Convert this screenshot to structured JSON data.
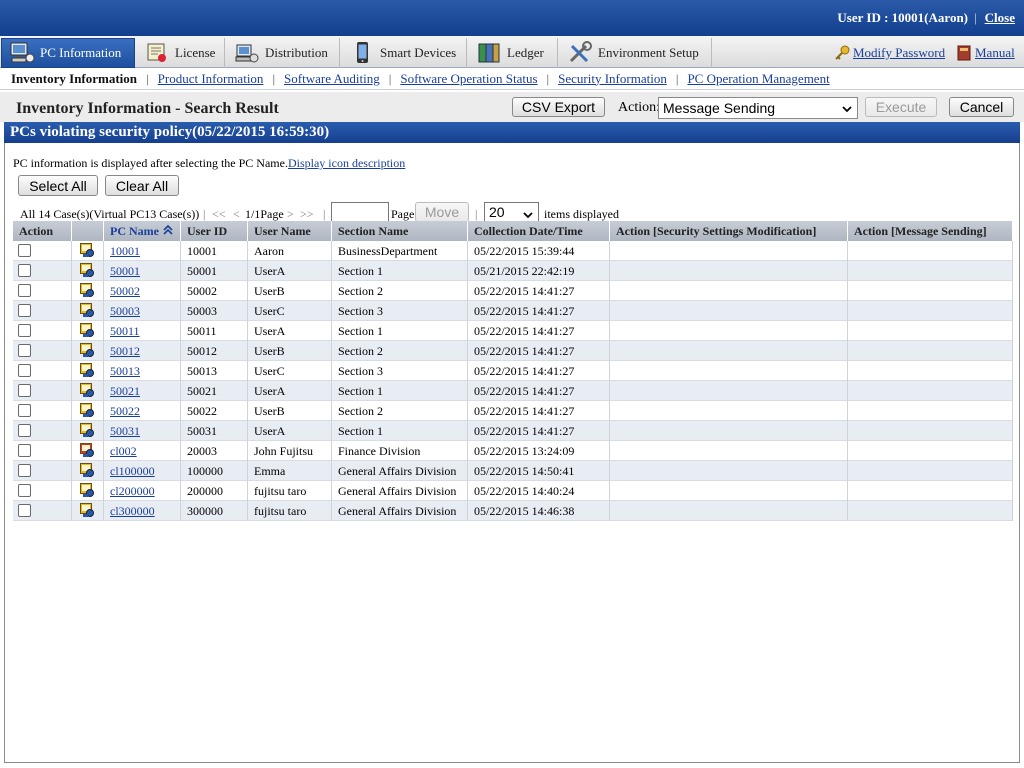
{
  "topbar": {
    "user_id": "User ID : 10001(Aaron)",
    "separator": "|",
    "close": "Close"
  },
  "tabs": [
    {
      "label": "PC Information",
      "icon": "pc-information-icon"
    },
    {
      "label": "License",
      "icon": "license-icon"
    },
    {
      "label": "Distribution",
      "icon": "distribution-icon"
    },
    {
      "label": "Smart Devices",
      "icon": "smart-devices-icon"
    },
    {
      "label": "Ledger",
      "icon": "ledger-icon"
    },
    {
      "label": "Environment Setup",
      "icon": "environment-setup-icon"
    }
  ],
  "header_links": {
    "modify_password": "Modify Password",
    "manual": "Manual"
  },
  "subnav": {
    "current": "Inventory Information",
    "links": [
      "Product Information",
      "Software Auditing",
      "Software Operation Status",
      "Security Information",
      "PC Operation Management"
    ],
    "separator": "|"
  },
  "page_title": "Inventory Information - Search Result",
  "toolbar": {
    "csv_export": "CSV Export",
    "action_label": "Action:",
    "action_value": "Message Sending",
    "execute": "Execute",
    "cancel": "Cancel"
  },
  "section_title": "PCs violating security policy(05/22/2015 16:59:30)",
  "info": {
    "text": "PC information is displayed after selecting the PC Name.",
    "link": "Display icon description"
  },
  "selection": {
    "select_all": "Select All",
    "clear_all": "Clear All"
  },
  "pager": {
    "total": "All 14 Case(s)(Virtual PC13 Case(s))",
    "first": "<<",
    "prev": "<",
    "current": "1/1Page",
    "next": ">",
    "last": ">>",
    "page_label": "Page",
    "move": "Move",
    "per_page": "20",
    "items_label": "items displayed",
    "separator": "|"
  },
  "table": {
    "columns": [
      "Action",
      "",
      "PC Name",
      "User ID",
      "User Name",
      "Section Name",
      "Collection Date/Time",
      "Action [Security Settings Modification]",
      "Action [Message Sending]"
    ],
    "rows": [
      {
        "pc": "10001",
        "uid": "10001",
        "user": "Aaron",
        "section": "BusinessDepartment",
        "time": "05/22/2015 15:39:44",
        "icon": "pc-yellow"
      },
      {
        "pc": "50001",
        "uid": "50001",
        "user": "UserA",
        "section": "Section 1",
        "time": "05/21/2015 22:42:19",
        "icon": "pc-yellow"
      },
      {
        "pc": "50002",
        "uid": "50002",
        "user": "UserB",
        "section": "Section 2",
        "time": "05/22/2015 14:41:27",
        "icon": "pc-yellow"
      },
      {
        "pc": "50003",
        "uid": "50003",
        "user": "UserC",
        "section": "Section 3",
        "time": "05/22/2015 14:41:27",
        "icon": "pc-yellow"
      },
      {
        "pc": "50011",
        "uid": "50011",
        "user": "UserA",
        "section": "Section 1",
        "time": "05/22/2015 14:41:27",
        "icon": "pc-yellow"
      },
      {
        "pc": "50012",
        "uid": "50012",
        "user": "UserB",
        "section": "Section 2",
        "time": "05/22/2015 14:41:27",
        "icon": "pc-yellow"
      },
      {
        "pc": "50013",
        "uid": "50013",
        "user": "UserC",
        "section": "Section 3",
        "time": "05/22/2015 14:41:27",
        "icon": "pc-yellow"
      },
      {
        "pc": "50021",
        "uid": "50021",
        "user": "UserA",
        "section": "Section 1",
        "time": "05/22/2015 14:41:27",
        "icon": "pc-yellow"
      },
      {
        "pc": "50022",
        "uid": "50022",
        "user": "UserB",
        "section": "Section 2",
        "time": "05/22/2015 14:41:27",
        "icon": "pc-yellow"
      },
      {
        "pc": "50031",
        "uid": "50031",
        "user": "UserA",
        "section": "Section 1",
        "time": "05/22/2015 14:41:27",
        "icon": "pc-yellow"
      },
      {
        "pc": "cl002",
        "uid": "20003",
        "user": "John Fujitsu",
        "section": "Finance Division",
        "time": "05/22/2015 13:24:09",
        "icon": "pc-red"
      },
      {
        "pc": "cl100000",
        "uid": "100000",
        "user": "Emma",
        "section": "General Affairs Division",
        "time": "05/22/2015 14:50:41",
        "icon": "pc-yellow"
      },
      {
        "pc": "cl200000",
        "uid": "200000",
        "user": "fujitsu taro",
        "section": "General Affairs Division",
        "time": "05/22/2015 14:40:24",
        "icon": "pc-yellow"
      },
      {
        "pc": "cl300000",
        "uid": "300000",
        "user": "fujitsu taro",
        "section": "General Affairs Division",
        "time": "05/22/2015 14:46:38",
        "icon": "pc-yellow"
      }
    ]
  },
  "colors": {
    "header_blue": "#1d4f9d",
    "link_blue": "#1a3f9a",
    "row_alt": "#e8edf4"
  }
}
